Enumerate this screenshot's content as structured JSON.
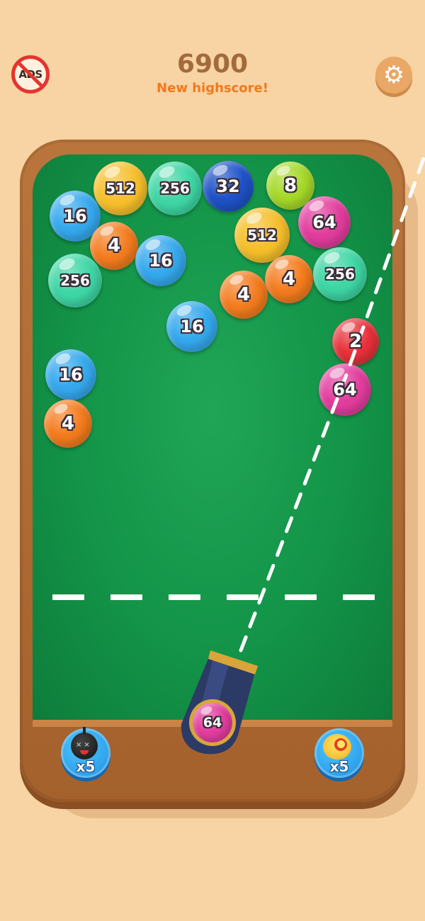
{
  "header": {
    "ads_icon_text": "ADS",
    "score": "6900",
    "highscore_label": "New highscore!"
  },
  "colors": {
    "background": "#f8d3a3",
    "board_frame": "#b06a32",
    "felt": "#139448",
    "score": "#a36a3d",
    "highscore": "#f07a1c",
    "ball_colors": {
      "2": "#e8313a",
      "4": "#f47c1e",
      "8": "#a6d92a",
      "16": "#35a9ee",
      "32": "#1f52c8",
      "64": "#e23d9e",
      "256": "#3ed6a4",
      "512": "#f6bf2b"
    }
  },
  "balls": [
    {
      "value": "512",
      "color": "#f6bf2b"
    },
    {
      "value": "256",
      "color": "#3ed6a4"
    },
    {
      "value": "32",
      "color": "#1f52c8"
    },
    {
      "value": "8",
      "color": "#a6d92a"
    },
    {
      "value": "16",
      "color": "#35a9ee"
    },
    {
      "value": "4",
      "color": "#f47c1e"
    },
    {
      "value": "16",
      "color": "#35a9ee"
    },
    {
      "value": "512",
      "color": "#f6bf2b"
    },
    {
      "value": "64",
      "color": "#e23d9e"
    },
    {
      "value": "256",
      "color": "#3ed6a4"
    },
    {
      "value": "4",
      "color": "#f47c1e"
    },
    {
      "value": "4",
      "color": "#f47c1e"
    },
    {
      "value": "256",
      "color": "#3ed6a4"
    },
    {
      "value": "16",
      "color": "#35a9ee"
    },
    {
      "value": "2",
      "color": "#e8313a"
    },
    {
      "value": "64",
      "color": "#e23d9e"
    },
    {
      "value": "16",
      "color": "#35a9ee"
    },
    {
      "value": "4",
      "color": "#f47c1e"
    }
  ],
  "shooter": {
    "value": "64",
    "color": "#e23d9e"
  },
  "boosters": {
    "bomb": {
      "icon": "bomb-icon",
      "count": "x5"
    },
    "fire": {
      "icon": "fireball-icon",
      "count": "x5"
    }
  },
  "icons": {
    "no_ads": "no-ads-icon",
    "settings": "gear-icon"
  }
}
